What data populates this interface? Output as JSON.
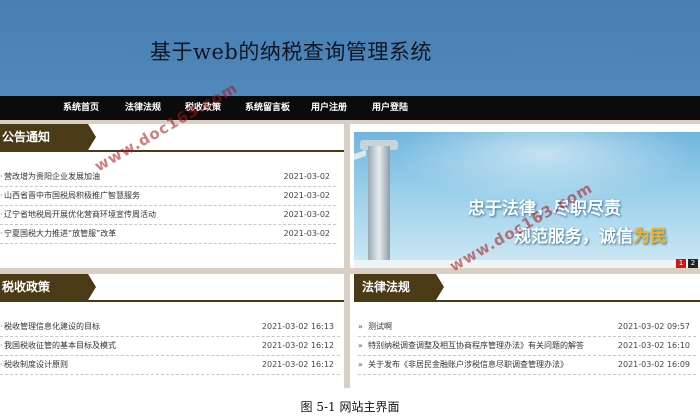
{
  "header": {
    "site_title": "基于web的纳税查询管理系统"
  },
  "nav": {
    "items": [
      {
        "label": "系统首页"
      },
      {
        "label": "法律法规"
      },
      {
        "label": "税收政策"
      },
      {
        "label": "系统留言板"
      },
      {
        "label": "用户注册"
      },
      {
        "label": "用户登陆"
      }
    ]
  },
  "notices": {
    "heading": "公告通知",
    "items": [
      {
        "title": "营改增为贵阳企业发展加油",
        "date": "2021-03-02"
      },
      {
        "title": "山西省晋中市国税局积极推广智慧服务",
        "date": "2021-03-02"
      },
      {
        "title": "辽宁省地税局开展优化营商环境宣传周活动",
        "date": "2021-03-02"
      },
      {
        "title": "宁夏国税大力推进“放管服”改革",
        "date": "2021-03-02"
      }
    ]
  },
  "banner_slide": {
    "slogan_line1": "忠于法律，尽职尽责",
    "slogan_line2_a": "规范服务，诚信",
    "slogan_line2_b": "为民",
    "indicator_1": "1",
    "indicator_2": "2"
  },
  "tax_policy": {
    "heading": "税收政策",
    "items": [
      {
        "title": "税收管理信息化建设的目标",
        "date": "2021-03-02 16:13"
      },
      {
        "title": "我国税收征管的基本目标及模式",
        "date": "2021-03-02 16:12"
      },
      {
        "title": "税收制度设计原则",
        "date": "2021-03-02 16:12"
      }
    ]
  },
  "laws": {
    "heading": "法律法规",
    "items": [
      {
        "title": "测试啊",
        "date": "2021-03-02 09:57"
      },
      {
        "title": "特别纳税调查调整及相互协商程序管理办法》有关问题的解答",
        "date": "2021-03-02 16:10"
      },
      {
        "title": "关于发布《非居民金融账户涉税信息尽职调查管理办法》",
        "date": "2021-03-02 16:09"
      }
    ]
  },
  "watermark": {
    "text": "www.doc163.com"
  },
  "caption": "图 5-1 网站主界面",
  "colors": {
    "banner": "#4c84b8",
    "nav": "#0b0b0b",
    "section_header": "#4a3a16",
    "gutter": "#d9cfc4",
    "slide_indicator_active": "#d01515"
  }
}
